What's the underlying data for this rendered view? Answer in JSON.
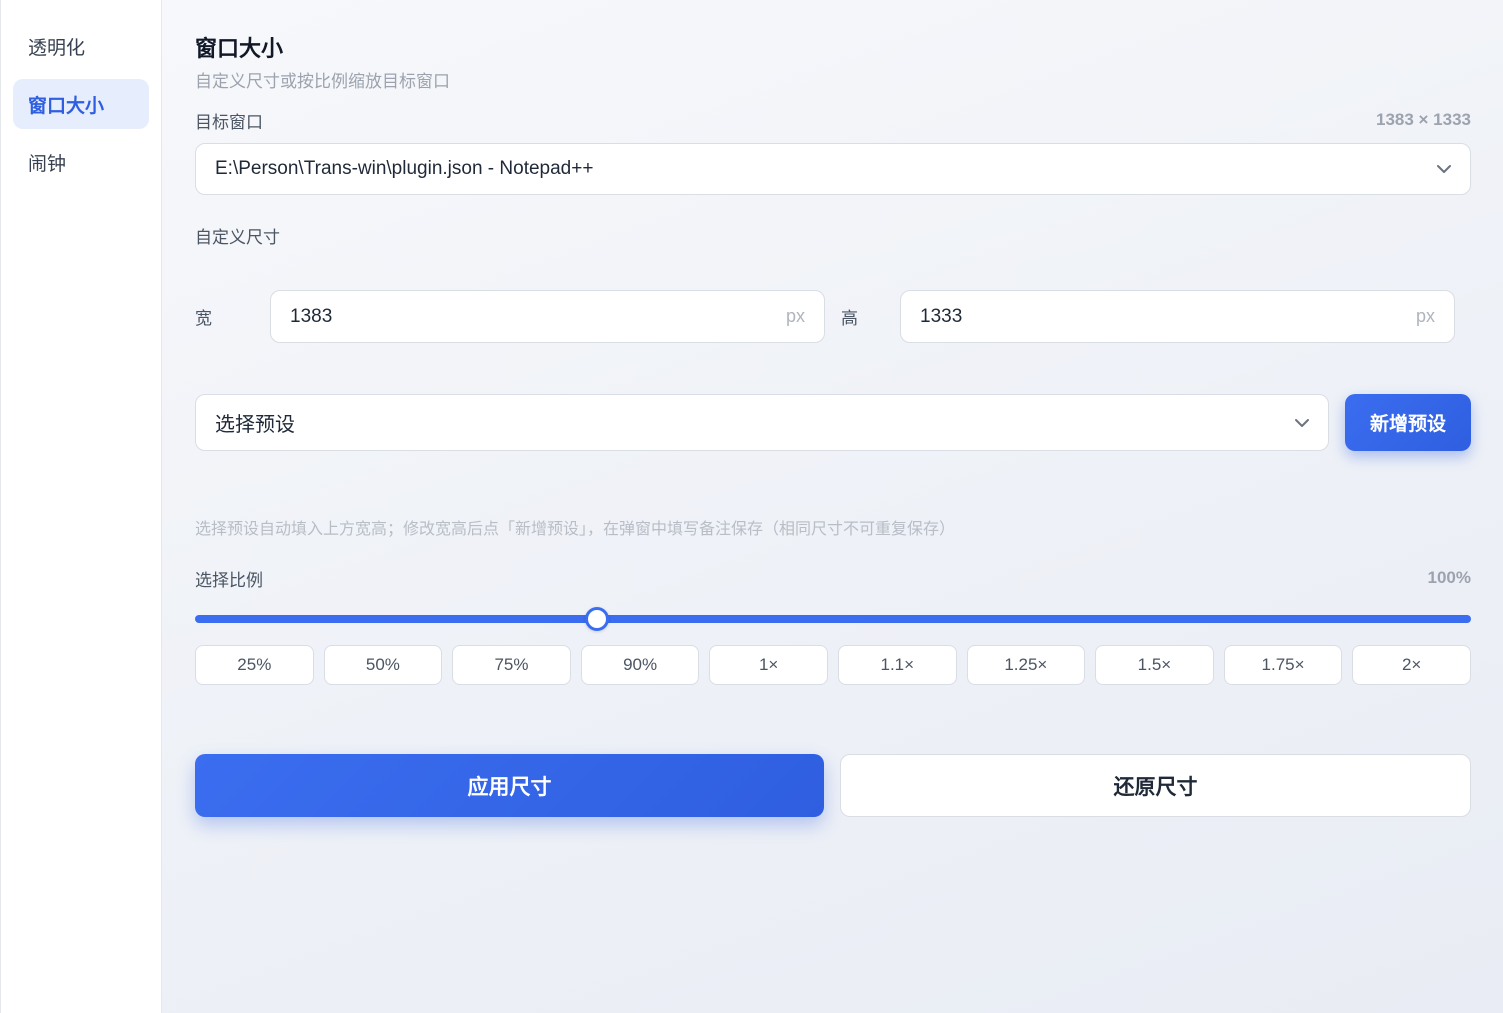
{
  "sidebar": {
    "items": [
      {
        "label": "透明化",
        "active": false
      },
      {
        "label": "窗口大小",
        "active": true
      },
      {
        "label": "闹钟",
        "active": false
      }
    ]
  },
  "header": {
    "title": "窗口大小",
    "subtitle": "自定义尺寸或按比例缩放目标窗口"
  },
  "target": {
    "label": "目标窗口",
    "dimensions": "1383 × 1333",
    "selected": "E:\\Person\\Trans-win\\plugin.json - Notepad++"
  },
  "custom_size": {
    "label": "自定义尺寸",
    "width_label": "宽",
    "width_value": "1383",
    "height_label": "高",
    "height_value": "1333",
    "unit": "px"
  },
  "preset": {
    "placeholder": "选择预设",
    "add_label": "新增预设",
    "hint": "选择预设自动填入上方宽高；修改宽高后点「新增预设」，在弹窗中填写备注保存（相同尺寸不可重复保存）"
  },
  "ratio": {
    "label": "选择比例",
    "value_text": "100%",
    "slider_fraction": 0.315,
    "options": [
      "25%",
      "50%",
      "75%",
      "90%",
      "1×",
      "1.1×",
      "1.25×",
      "1.5×",
      "1.75×",
      "2×"
    ]
  },
  "actions": {
    "apply_label": "应用尺寸",
    "restore_label": "还原尺寸"
  },
  "colors": {
    "accent": "#3b6df0",
    "active_bg": "#e6edfc"
  }
}
